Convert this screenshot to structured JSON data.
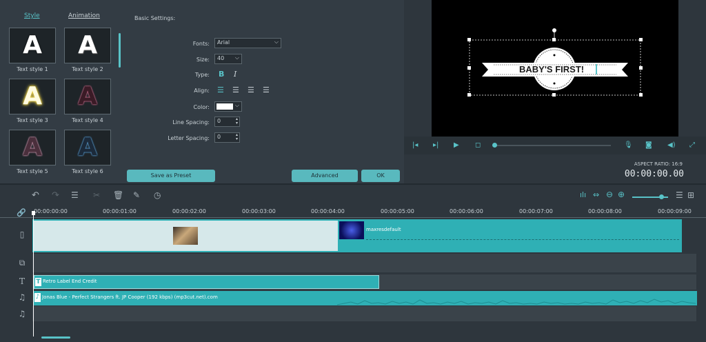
{
  "tabs": {
    "style": "Style",
    "animation": "Animation"
  },
  "text_styles": [
    {
      "label": "Text style 1"
    },
    {
      "label": "Text style 2"
    },
    {
      "label": "Text style 3"
    },
    {
      "label": "Text style 4"
    },
    {
      "label": "Text style 5"
    },
    {
      "label": "Text style 6"
    }
  ],
  "thumb_letter": "A",
  "basic_settings": "Basic Settings:",
  "fonts": {
    "label": "Fonts:",
    "value": "Arial"
  },
  "size": {
    "label": "Size:",
    "value": "40"
  },
  "type": {
    "label": "Type:",
    "bold": "B",
    "italic": "I"
  },
  "align": {
    "label": "Align:"
  },
  "color": {
    "label": "Color:",
    "value": "#ffffff"
  },
  "line_spacing": {
    "label": "Line Spacing:",
    "value": "0"
  },
  "letter_spacing": {
    "label": "Letter Spacing:",
    "value": "0"
  },
  "buttons": {
    "save_preset": "Save as Preset",
    "advanced": "Advanced",
    "ok": "OK"
  },
  "preview_text": "BABY'S FIRST!",
  "aspect_ratio": "ASPECT RATIO: 16:9",
  "timecode": "00:00:00.00",
  "ruler": [
    "00:00:00:00",
    "00:00:01:00",
    "00:00:02:00",
    "00:00:03:00",
    "00:00:04:00",
    "00:00:05:00",
    "00:00:06:00",
    "00:00:07:00",
    "00:00:08:00",
    "00:00:09:00"
  ],
  "clips": {
    "video2": "maxresdefault",
    "title": "Retro Label End Credit",
    "audio": "Jonas Blue - Perfect Strangers ft. JP Cooper (192 kbps) (mp3cut.net).com"
  },
  "colors": {
    "accent": "#59c3c8",
    "clip": "#2fb0b5"
  }
}
